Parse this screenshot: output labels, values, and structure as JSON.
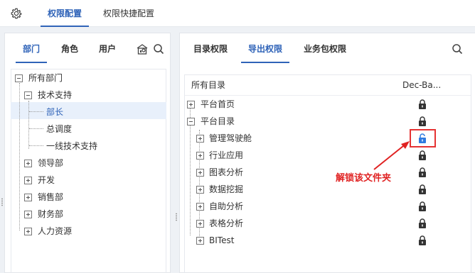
{
  "top_tabs": [
    {
      "label": "权限配置",
      "active": true
    },
    {
      "label": "权限快捷配置",
      "active": false
    }
  ],
  "left_panel": {
    "tabs": [
      {
        "label": "部门",
        "active": true
      },
      {
        "label": "角色",
        "active": false
      },
      {
        "label": "用户",
        "active": false
      }
    ],
    "tree": [
      {
        "label": "所有部门",
        "level": 0,
        "expanded": true
      },
      {
        "label": "技术支持",
        "level": 1,
        "expanded": true
      },
      {
        "label": "部长",
        "level": 2,
        "selected": true
      },
      {
        "label": "总调度",
        "level": 2
      },
      {
        "label": "一线技术支持",
        "level": 2
      },
      {
        "label": "领导部",
        "level": 1,
        "expanded": false
      },
      {
        "label": "开发",
        "level": 1,
        "expanded": false
      },
      {
        "label": "销售部",
        "level": 1,
        "expanded": false
      },
      {
        "label": "财务部",
        "level": 1,
        "expanded": false
      },
      {
        "label": "人力资源",
        "level": 1,
        "expanded": false
      }
    ]
  },
  "right_panel": {
    "tabs": [
      {
        "label": "目录权限",
        "active": false
      },
      {
        "label": "导出权限",
        "active": true
      },
      {
        "label": "业务包权限",
        "active": false
      }
    ],
    "table": {
      "col_name": "所有目录",
      "col_perm": "Dec-Ba...",
      "rows": [
        {
          "label": "平台首页",
          "level": 0,
          "expanded": false,
          "lock": "locked"
        },
        {
          "label": "平台目录",
          "level": 0,
          "expanded": true,
          "lock": "locked"
        },
        {
          "label": "管理驾驶舱",
          "level": 1,
          "expanded": false,
          "lock": "unlocked"
        },
        {
          "label": "行业应用",
          "level": 1,
          "expanded": false,
          "lock": "locked"
        },
        {
          "label": "图表分析",
          "level": 1,
          "expanded": false,
          "lock": "locked"
        },
        {
          "label": "数据挖掘",
          "level": 1,
          "expanded": false,
          "lock": "locked"
        },
        {
          "label": "自助分析",
          "level": 1,
          "expanded": false,
          "lock": "locked"
        },
        {
          "label": "表格分析",
          "level": 1,
          "expanded": false,
          "lock": "locked"
        },
        {
          "label": "BITest",
          "level": 1,
          "expanded": false,
          "lock": "locked"
        }
      ]
    }
  },
  "annotation": {
    "text": "解锁该文件夹",
    "color": "#e02222"
  },
  "colors": {
    "accent": "#2f63b8",
    "unlock": "#2f7be0",
    "lock": "#333333",
    "selected_bg": "#e8f0fb"
  }
}
